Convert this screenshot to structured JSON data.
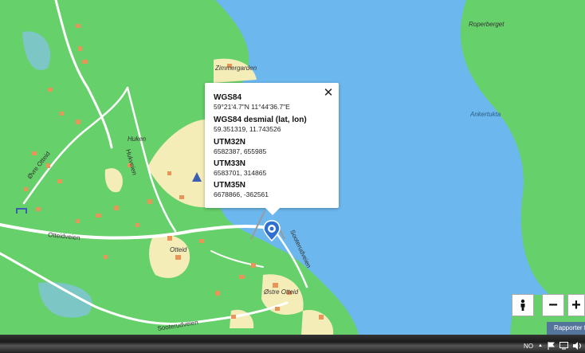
{
  "map": {
    "places": [
      "Zimmergarden",
      "Huken",
      "Otteid",
      "Østre Otteid",
      "Roperberget",
      "Ankertukta"
    ],
    "roads": [
      "Øvre Otteid",
      "Hukveien",
      "Otteidveien",
      "Sooterudveien",
      "Sooterudveien"
    ],
    "colors": {
      "water": "#6cb8ee",
      "land": "#66d06a",
      "field": "#f5edb8",
      "building": "#e8955a"
    }
  },
  "popup": {
    "entries": [
      {
        "title": "WGS84",
        "value": "59°21'4.7\"N 11°44'36.7\"E"
      },
      {
        "title": "WGS84 desmial (lat, lon)",
        "value": "59.351319, 11.743526"
      },
      {
        "title": "UTM32N",
        "value": "6582387, 655985"
      },
      {
        "title": "UTM33N",
        "value": "6583701, 314865"
      },
      {
        "title": "UTM35N",
        "value": "6678866, -362561"
      }
    ],
    "close_icon": "close-icon"
  },
  "controls": {
    "zoom_out": "−",
    "zoom_in": "+",
    "person_icon": "person-icon"
  },
  "report_label": "Rapporter f",
  "taskbar": {
    "language": "NO",
    "chevron": "▲"
  }
}
